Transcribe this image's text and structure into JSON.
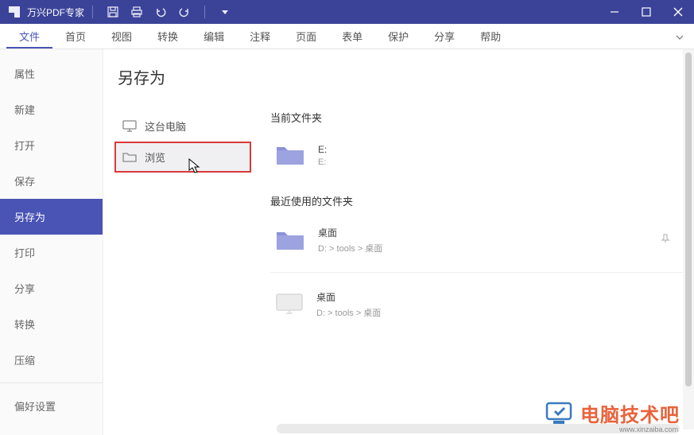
{
  "app": {
    "title": "万兴PDF专家"
  },
  "menu": {
    "items": [
      "文件",
      "首页",
      "视图",
      "转换",
      "编辑",
      "注释",
      "页面",
      "表单",
      "保护",
      "分享",
      "帮助"
    ],
    "active_index": 0
  },
  "file_sidebar": {
    "items": [
      "属性",
      "新建",
      "打开",
      "保存",
      "另存为",
      "打印",
      "分享",
      "转换",
      "压缩"
    ],
    "active_index": 4,
    "footer": "偏好设置"
  },
  "saveas": {
    "title": "另存为",
    "locations": [
      {
        "icon": "monitor",
        "label": "这台电脑"
      },
      {
        "icon": "folder-outline",
        "label": "浏览"
      }
    ],
    "highlighted_index": 1
  },
  "right": {
    "current_section": "当前文件夹",
    "current_folder": {
      "name": "E:",
      "path": "E:"
    },
    "recent_section": "最近使用的文件夹",
    "recent_folders": [
      {
        "name": "桌面",
        "path": "D: > tools > 桌面",
        "icon": "folder",
        "pinned": true
      },
      {
        "name": "桌面",
        "path": "D: > tools > 桌面",
        "icon": "monitor"
      }
    ]
  },
  "watermark": {
    "text": "电脑技术吧",
    "sub": "www.xinzaiba.com"
  }
}
